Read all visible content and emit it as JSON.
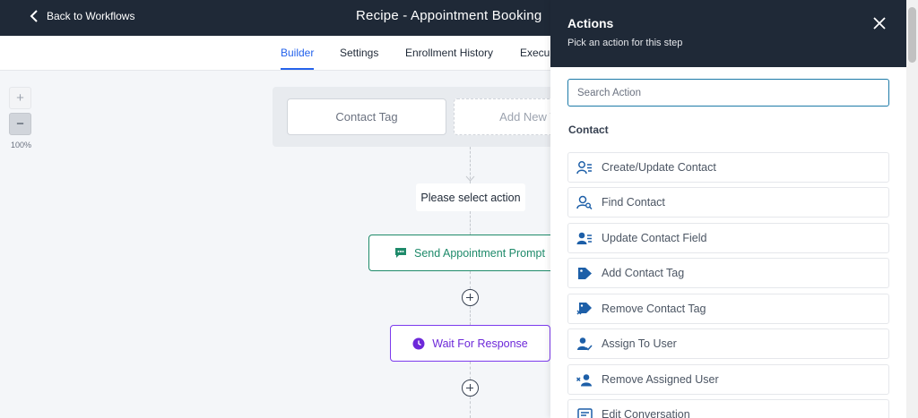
{
  "header": {
    "back_label": "Back to Workflows",
    "title": "Recipe - Appointment Booking"
  },
  "tabs": [
    {
      "label": "Builder",
      "active": true
    },
    {
      "label": "Settings"
    },
    {
      "label": "Enrollment History"
    },
    {
      "label": "Execu"
    }
  ],
  "zoom": {
    "plus": "+",
    "minus": "−",
    "level": "100%"
  },
  "canvas": {
    "triggers": [
      "Contact Tag",
      "Add New Wo"
    ],
    "select_action": "Please select action",
    "steps": [
      {
        "label": "Send Appointment Prompt",
        "icon": "chat-bubble-icon",
        "color": "#1e8a6a"
      },
      {
        "label": "Wait For Response",
        "icon": "clock-icon",
        "color": "#6d28d9"
      }
    ]
  },
  "panel": {
    "title": "Actions",
    "subtitle": "Pick an action for this step",
    "search_placeholder": "Search Action",
    "section": "Contact",
    "actions": [
      {
        "label": "Create/Update Contact",
        "icon": "contact-list-icon"
      },
      {
        "label": "Find Contact",
        "icon": "find-contact-icon"
      },
      {
        "label": "Update Contact Field",
        "icon": "update-field-icon"
      },
      {
        "label": "Add Contact Tag",
        "icon": "tag-icon"
      },
      {
        "label": "Remove Contact Tag",
        "icon": "remove-tag-icon"
      },
      {
        "label": "Assign To User",
        "icon": "assign-user-icon"
      },
      {
        "label": "Remove Assigned User",
        "icon": "remove-user-icon"
      },
      {
        "label": "Edit Conversation",
        "icon": "conversation-icon"
      }
    ]
  },
  "colors": {
    "header_bg": "#1f2937",
    "accent": "#2563eb",
    "icon_blue": "#1d5fa8"
  }
}
